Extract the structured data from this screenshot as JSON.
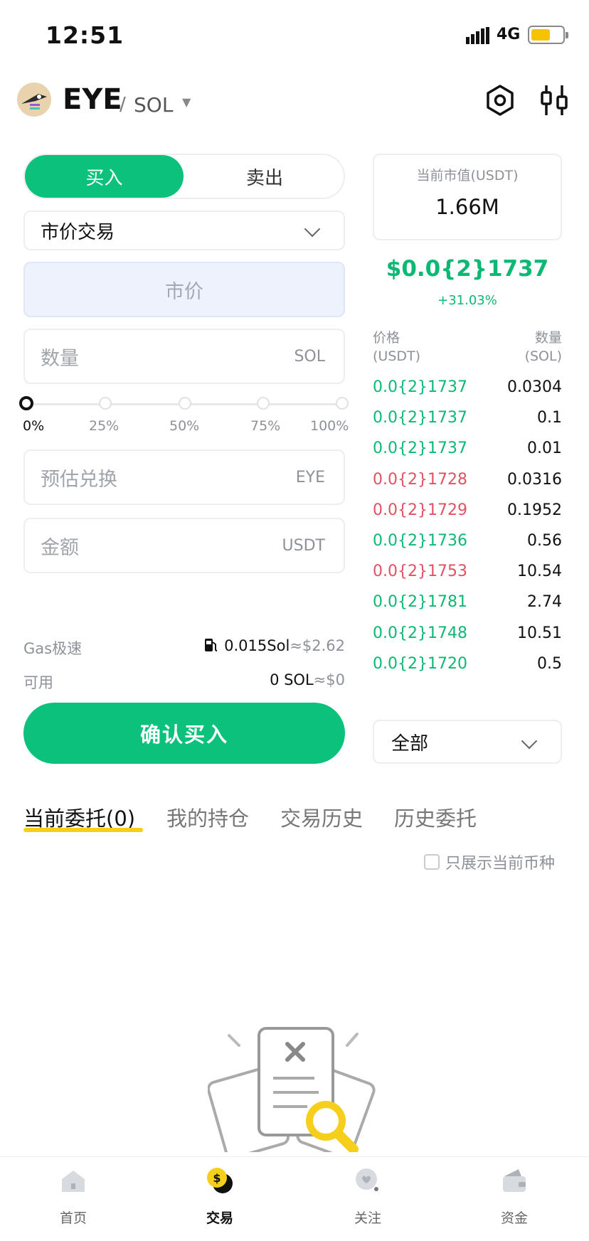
{
  "status_bar": {
    "time": "12:51",
    "network": "4G"
  },
  "header": {
    "token": "EYE",
    "separator": "/",
    "quote": "SOL"
  },
  "trade": {
    "buy_label": "买入",
    "sell_label": "卖出",
    "order_type": "市价交易",
    "price_placeholder": "市价",
    "amount_placeholder": "数量",
    "amount_unit": "SOL",
    "slider": {
      "value_percent": 0,
      "labels": [
        "0%",
        "25%",
        "50%",
        "75%",
        "100%"
      ]
    },
    "estimate_placeholder": "预估兑换",
    "estimate_unit": "EYE",
    "total_placeholder": "金额",
    "total_unit": "USDT",
    "gas_label": "Gas极速",
    "gas_value": "0.015Sol",
    "gas_approx": "≈$2.62",
    "available_label": "可用",
    "available_value": "0 SOL",
    "available_approx": "≈$0",
    "confirm_label": "确认买入"
  },
  "market": {
    "mcap_label": "当前市值(USDT)",
    "mcap_value": "1.66M",
    "price": "$0.0{2}1737",
    "change": "+31.03%"
  },
  "orderbook": {
    "price_header": "价格",
    "price_unit": "(USDT)",
    "qty_header": "数量",
    "qty_unit": "(SOL)",
    "rows": [
      {
        "price": "0.0{2}1737",
        "qty": "0.0304",
        "dir": "up"
      },
      {
        "price": "0.0{2}1737",
        "qty": "0.1",
        "dir": "up"
      },
      {
        "price": "0.0{2}1737",
        "qty": "0.01",
        "dir": "up"
      },
      {
        "price": "0.0{2}1728",
        "qty": "0.0316",
        "dir": "down"
      },
      {
        "price": "0.0{2}1729",
        "qty": "0.1952",
        "dir": "down"
      },
      {
        "price": "0.0{2}1736",
        "qty": "0.56",
        "dir": "up"
      },
      {
        "price": "0.0{2}1753",
        "qty": "10.54",
        "dir": "down"
      },
      {
        "price": "0.0{2}1781",
        "qty": "2.74",
        "dir": "up"
      },
      {
        "price": "0.0{2}1748",
        "qty": "10.51",
        "dir": "up"
      },
      {
        "price": "0.0{2}1720",
        "qty": "0.5",
        "dir": "up"
      }
    ],
    "filter": "全部"
  },
  "tabs": [
    "当前委托(0)",
    "我的持仓",
    "交易历史",
    "历史委托"
  ],
  "only_current_label": "只展示当前币种",
  "bottom_nav": [
    "首页",
    "交易",
    "关注",
    "资金"
  ],
  "colors": {
    "green": "#0cc17c",
    "up": "#0cb874",
    "down": "#e05263",
    "accent_yellow": "#f6cf1d"
  },
  "icons": [
    "settings-hex-icon",
    "candlestick-chart-icon",
    "gas-pump-icon",
    "home-icon",
    "trade-icon",
    "follow-icon",
    "wallet-icon"
  ]
}
